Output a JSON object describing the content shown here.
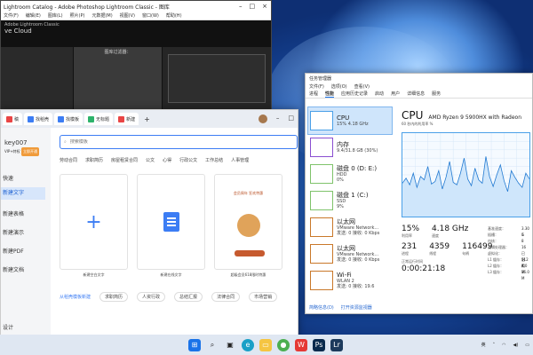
{
  "lightroom": {
    "title": "Lightroom Catalog - Adobe Photoshop Lightroom Classic - 图库",
    "menu": [
      "文件(F)",
      "编辑(E)",
      "图库(L)",
      "照片(P)",
      "元数据(M)",
      "视图(V)",
      "窗口(W)",
      "帮助(H)"
    ],
    "brand": "Adobe Lightroom Classic",
    "catalog": "ve Cloud",
    "panel": "图库过滤器："
  },
  "taskmgr": {
    "title": "任务管理器",
    "menu": [
      "文件(F)",
      "选项(O)",
      "查看(V)"
    ],
    "tabs": [
      "进程",
      "性能",
      "应用历史记录",
      "启动",
      "用户",
      "详细信息",
      "服务"
    ],
    "items": [
      {
        "name": "CPU",
        "sub": "15% 4.18 GHz"
      },
      {
        "name": "内存",
        "sub": "9.4/31.8 GB (30%)"
      },
      {
        "name": "磁盘 0 (D: E:)",
        "sub": "HDD",
        "sub2": "0%"
      },
      {
        "name": "磁盘 1 (C:)",
        "sub": "SSD",
        "sub2": "9%"
      },
      {
        "name": "以太网",
        "sub": "VMware Network...",
        "sub2": "发送: 0 接收: 0 Kbps"
      },
      {
        "name": "以太网",
        "sub": "VMware Network...",
        "sub2": "发送: 0 接收: 0 Kbps"
      },
      {
        "name": "Wi-Fi",
        "sub": "WLAN 2",
        "sub2": "发送: 0 接收: 19.6"
      }
    ],
    "cpu_label": "CPU",
    "cpu_model": "AMD Ryzen 9 5900HX with Radeon",
    "graph_label": "60 秒内的利用率 %",
    "stats": [
      {
        "label": "利用率",
        "value": "15%"
      },
      {
        "label": "速度",
        "value": "4.18 GHz"
      }
    ],
    "stats2": [
      {
        "label": "进程",
        "value": "231"
      },
      {
        "label": "线程",
        "value": "4359"
      },
      {
        "label": "句柄",
        "value": "116499"
      }
    ],
    "uptime_label": "正常运行时间",
    "uptime": "0:00:21:18",
    "right": [
      {
        "k": "基准速度：",
        "v": "3.30 G"
      },
      {
        "k": "插槽：",
        "v": "1"
      },
      {
        "k": "内核：",
        "v": "8"
      },
      {
        "k": "逻辑处理器：",
        "v": "16"
      },
      {
        "k": "虚拟化：",
        "v": "已启用"
      },
      {
        "k": "L1 缓存：",
        "v": "512 K"
      },
      {
        "k": "L2 缓存：",
        "v": "4.0 M"
      },
      {
        "k": "L3 缓存：",
        "v": "16.0 M"
      }
    ],
    "footer": [
      "简略信息(D)",
      "打开资源监视器"
    ],
    "cpu_history": [
      40,
      46,
      38,
      52,
      35,
      48,
      44,
      60,
      39,
      42,
      55,
      33,
      47,
      66,
      41,
      38,
      52,
      70,
      45,
      37,
      58,
      44,
      40,
      72,
      48,
      36,
      50,
      62,
      43,
      30,
      55,
      47,
      40,
      35,
      52,
      45
    ]
  },
  "wps": {
    "tabs": [
      {
        "label": "稿",
        "color": "#e94545"
      },
      {
        "label": "找稻壳",
        "color": "#3c7df4"
      },
      {
        "label": "找模板",
        "color": "#3c7df4"
      },
      {
        "label": "无标题",
        "color": "#2db36b"
      },
      {
        "label": "新建",
        "color": "#e94545"
      }
    ],
    "add_tab": "+",
    "user": "key007",
    "vip": "VIP+特权",
    "vip_btn": "立即开通",
    "nav": [
      "快速",
      "新建文字",
      "新建表格",
      "新建演示",
      "新建PDF",
      "新建文档",
      "设计"
    ],
    "search_placeholder": "搜索模板",
    "cats": [
      "劳动合同",
      "求职简历",
      "房屋租赁合同",
      "公文",
      "心得",
      "行政公文",
      "工作总结",
      "人事管理"
    ],
    "cards": [
      {
        "caption": "新建空白文字"
      },
      {
        "caption": "新建在线文字"
      },
      {
        "caption": "超级会员618限时特惠"
      }
    ],
    "promo": "会员周年 狂欢特惠",
    "templates_title": "从稻壳模板新建",
    "templates": [
      "求职简历",
      "人资行政",
      "总结汇报",
      "法律合同",
      "市场营销"
    ]
  },
  "taskbar": {
    "icons": [
      "start",
      "search",
      "taskview",
      "edge",
      "explorer",
      "chrome",
      "wps",
      "photoshop",
      "lightroom"
    ],
    "ime": "英",
    "time": "",
    "icon_colors": {
      "start": "#1a73e8",
      "wps": "#e53935",
      "lightroom": "#1c3a5c"
    }
  }
}
